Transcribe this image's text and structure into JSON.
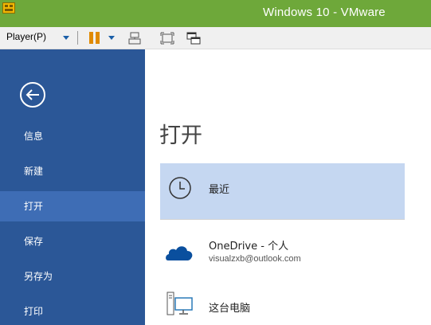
{
  "window": {
    "title": "Windows 10 - VMware"
  },
  "toolbar": {
    "player_menu_label": "Player(P)",
    "icons": [
      "player-dropdown-icon",
      "pause-icon",
      "pause-dropdown-icon",
      "send-ctrl-alt-del-icon",
      "fit-guest-icon",
      "unity-mode-icon"
    ]
  },
  "sidebar": {
    "back_icon": "back-arrow-icon",
    "items": [
      {
        "label": "信息"
      },
      {
        "label": "新建"
      },
      {
        "label": "打开"
      },
      {
        "label": "保存"
      },
      {
        "label": "另存为"
      },
      {
        "label": "打印"
      }
    ],
    "selected_index": 2
  },
  "main": {
    "title": "打开",
    "locations": [
      {
        "label": "最近",
        "icon": "clock-icon"
      },
      {
        "label": "OneDrive - 个人",
        "sublabel": "visualzxb@outlook.com",
        "icon": "onedrive-cloud-icon"
      },
      {
        "label": "这台电脑",
        "icon": "computer-icon"
      }
    ]
  },
  "colors": {
    "titlebar": "#6ea83a",
    "sidebar": "#2b5797",
    "sidebar_selected": "#3e6db5",
    "location_selected": "#c5d7f1",
    "onedrive_blue": "#0a4f9e"
  }
}
